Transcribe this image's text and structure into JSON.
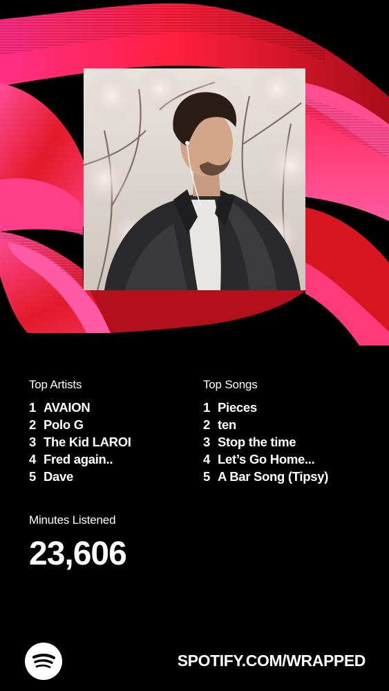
{
  "background_colors": {
    "base": "#000000",
    "accent_red": "#e01a1a",
    "accent_pink": "#ff3b7f"
  },
  "photo": {
    "icon": "artist-photo"
  },
  "top_artists": {
    "title": "Top Artists",
    "items": [
      {
        "rank": "1",
        "name": "AVAION"
      },
      {
        "rank": "2",
        "name": "Polo G"
      },
      {
        "rank": "3",
        "name": "The Kid LAROI"
      },
      {
        "rank": "4",
        "name": "Fred again.."
      },
      {
        "rank": "5",
        "name": "Dave"
      }
    ]
  },
  "top_songs": {
    "title": "Top Songs",
    "items": [
      {
        "rank": "1",
        "name": "Pieces"
      },
      {
        "rank": "2",
        "name": "ten"
      },
      {
        "rank": "3",
        "name": "Stop the time"
      },
      {
        "rank": "4",
        "name": "Let’s Go Home..."
      },
      {
        "rank": "5",
        "name": "A Bar Song (Tipsy)"
      }
    ]
  },
  "minutes": {
    "title": "Minutes Listened",
    "value": "23,606"
  },
  "footer": {
    "logo_icon": "spotify-logo-icon",
    "url": "SPOTIFY.COM/WRAPPED"
  }
}
